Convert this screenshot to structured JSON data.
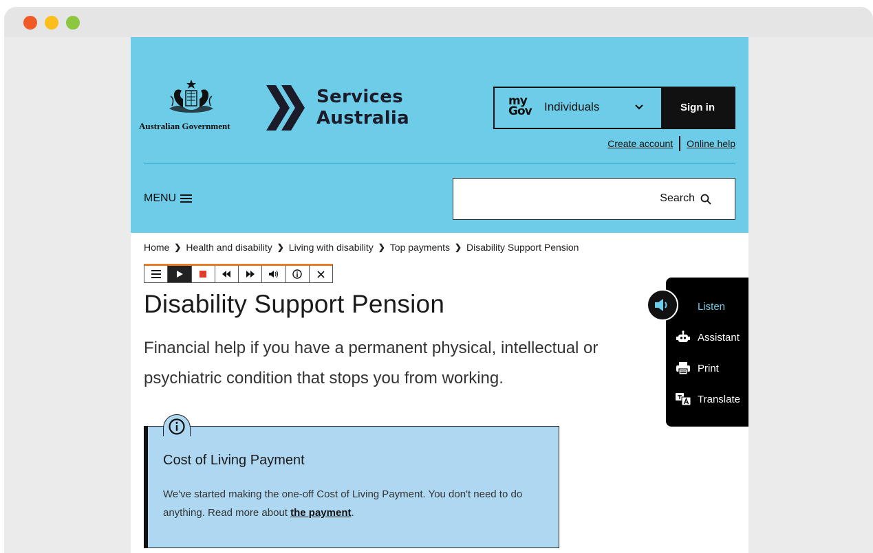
{
  "header": {
    "gov_name": "Australian Government",
    "brand_line1": "Services",
    "brand_line2": "Australia",
    "mygov_logo_top": "my",
    "mygov_logo_bottom": "Gov",
    "mygov_selected": "Individuals",
    "sign_in": "Sign in",
    "create_account": "Create account",
    "online_help": "Online help",
    "menu": "MENU",
    "search": "Search"
  },
  "breadcrumb": [
    "Home",
    "Health and disability",
    "Living with disability",
    "Top payments",
    "Disability Support Pension"
  ],
  "main": {
    "title": "Disability Support Pension",
    "lead": "Financial help if you have a permanent physical, intellectual or psychiatric condition that stops you from working."
  },
  "notice": {
    "title": "Cost of Living Payment",
    "body_before": "We've started making the one-off Cost of Living Payment. You don't need to do anything. Read more about ",
    "link": "the payment",
    "body_after": "."
  },
  "toolbox": {
    "listen": "Listen",
    "assistant": "Assistant",
    "print": "Print",
    "translate": "Translate"
  },
  "colors": {
    "header_bg": "#6dcde9",
    "notice_bg": "#aed8f2",
    "listen_accent": "#6dcde9",
    "player_accent": "#e77b26"
  }
}
